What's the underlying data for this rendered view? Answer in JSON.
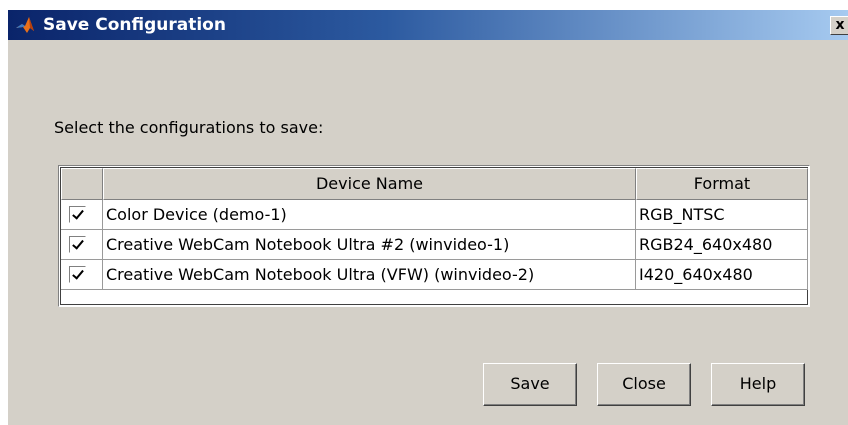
{
  "window": {
    "title": "Save Configuration",
    "close_label": "x"
  },
  "instruction": "Select the configurations to save:",
  "table": {
    "headers": {
      "check": "",
      "device_name": "Device Name",
      "format": "Format"
    },
    "rows": [
      {
        "checked": true,
        "device_name": "Color Device (demo-1)",
        "format": "RGB_NTSC"
      },
      {
        "checked": true,
        "device_name": "Creative WebCam Notebook Ultra #2 (winvideo-1)",
        "format": "RGB24_640x480"
      },
      {
        "checked": true,
        "device_name": "Creative WebCam Notebook Ultra (VFW) (winvideo-2)",
        "format": "I420_640x480"
      }
    ]
  },
  "buttons": {
    "save": "Save",
    "close": "Close",
    "help": "Help"
  },
  "colors": {
    "title_start": "#0a246a",
    "title_end": "#a6caf0",
    "face": "#d4d0c8"
  },
  "icons": {
    "app": "matlab-logo-icon",
    "check": "checkmark-icon"
  }
}
